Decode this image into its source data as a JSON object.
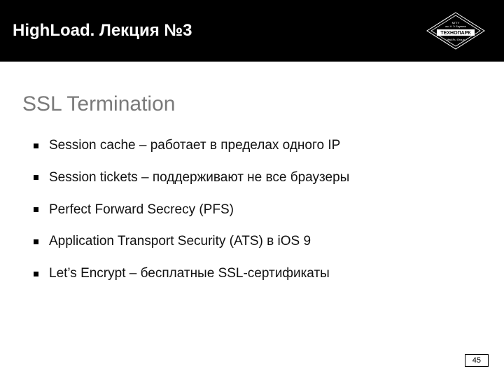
{
  "header": {
    "title": "HighLoad. Лекция №3",
    "logo": {
      "top_line": "МГТУ",
      "mid_line": "им. Н. Э. Баумана",
      "brand": "ТЕХНОПАРК",
      "bottom_line": "Mail.Ru Group"
    }
  },
  "section": {
    "title": "SSL Termination"
  },
  "bullets": [
    "Session cache – работает в пределах одного IP",
    "Session tickets – поддерживают не все браузеры",
    "Perfect Forward Secrecy (PFS)",
    "Application Transport Security (ATS) в iOS 9",
    "Let’s Encrypt – бесплатные SSL-сертификаты"
  ],
  "page_number": "45"
}
